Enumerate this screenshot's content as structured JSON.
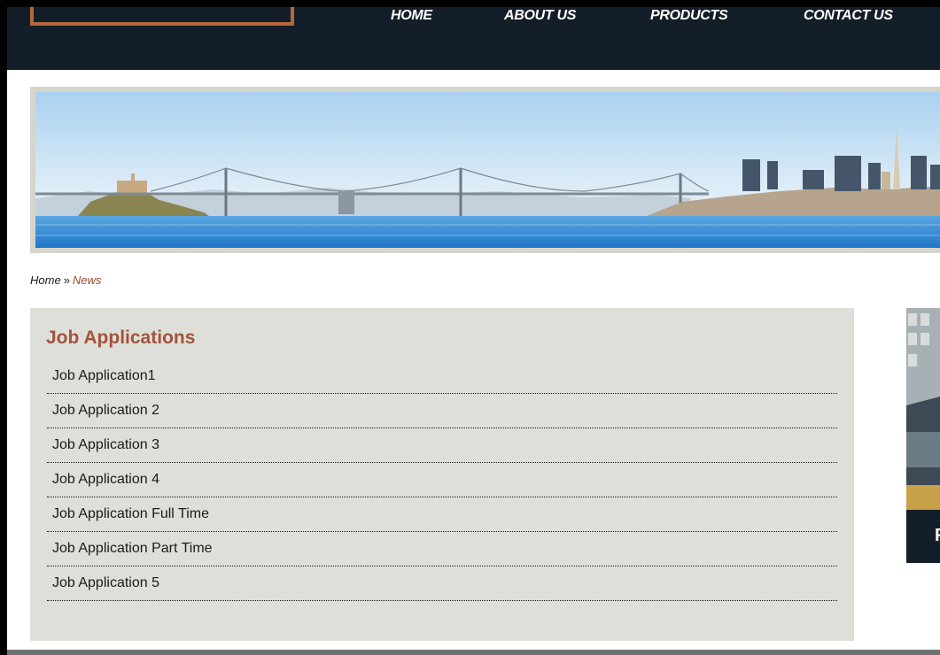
{
  "nav": {
    "items": [
      {
        "label": "HOME"
      },
      {
        "label": "ABOUT US"
      },
      {
        "label": "PRODUCTS"
      },
      {
        "label": "CONTACT US"
      }
    ]
  },
  "banner": {
    "image_name": "san-francisco-bay-panorama"
  },
  "breadcrumb": {
    "home": "Home",
    "separator": "»",
    "current": "News"
  },
  "panel": {
    "title": "Job Applications",
    "items": [
      {
        "label": "Job Application1"
      },
      {
        "label": "Job Application 2"
      },
      {
        "label": "Job Application 3"
      },
      {
        "label": "Job Application 4"
      },
      {
        "label": "Job Application Full Time"
      },
      {
        "label": "Job Application Part Time"
      },
      {
        "label": "Job Application 5"
      }
    ]
  },
  "side_ad": {
    "text": "F"
  },
  "colors": {
    "header_bg": "#141e28",
    "accent": "#b7683f",
    "title": "#a1543a",
    "breadcrumb_current": "#9b4a2e",
    "panel_bg": "#dfdfda"
  }
}
